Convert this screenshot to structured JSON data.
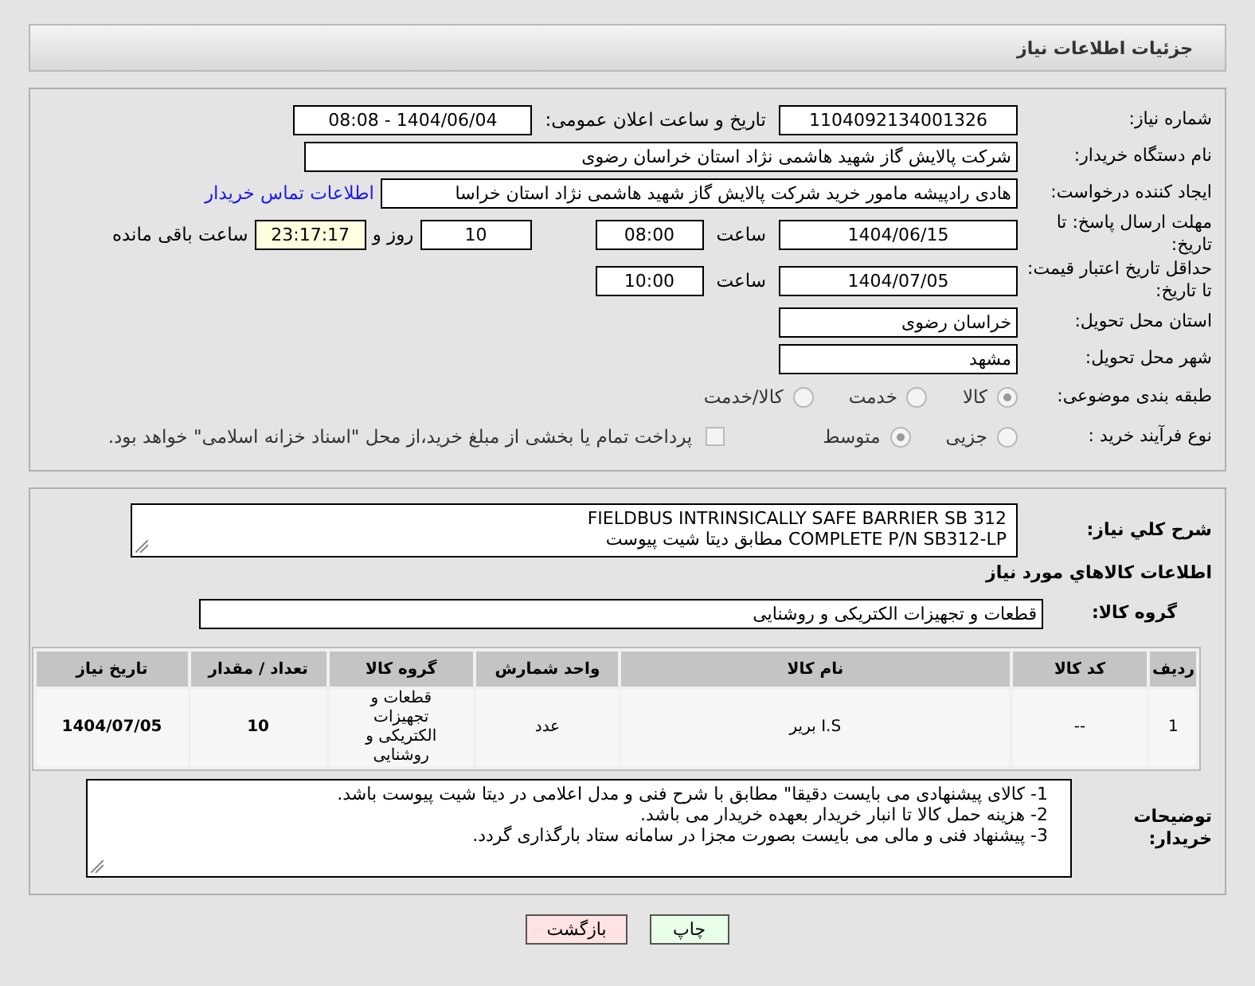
{
  "header": {
    "title": "جزئیات اطلاعات نیاز"
  },
  "need_number": {
    "label": "شماره نیاز:",
    "value": "1104092134001326"
  },
  "announce": {
    "label": "تاريخ و ساعت اعلان عمومی:",
    "value": "1404/06/04 - 08:08"
  },
  "buyer_org": {
    "label": "نام دستگاه خريدار:",
    "value": "شرکت پالایش گاز شهید هاشمی نژاد   استان خراسان رضوی"
  },
  "requester": {
    "label": "ايجاد کننده درخواست:",
    "value": "هادی رادپیشه مامور خرید شرکت پالایش گاز شهید هاشمی نژاد   استان خراسا",
    "link": "اطلاعات تماس خريدار"
  },
  "deadline": {
    "label": "مهلت ارسال پاسخ: تا تاريخ:",
    "date": "1404/06/15",
    "time_label": "ساعت",
    "time": "08:00",
    "days": "10",
    "days_label": "روز و",
    "remaining": "23:17:17",
    "remaining_label": "ساعت باقی مانده"
  },
  "validity": {
    "label": "حداقل تاريخ اعتبار قيمت: تا تاريخ:",
    "date": "1404/07/05",
    "time_label": "ساعت",
    "time": "10:00"
  },
  "province": {
    "label": "استان محل تحويل:",
    "value": "خراسان رضوی"
  },
  "city": {
    "label": "شهر محل تحويل:",
    "value": "مشهد"
  },
  "category": {
    "label": "طبقه بندی موضوعی:",
    "options": [
      {
        "label": "کالا",
        "selected": true
      },
      {
        "label": "خدمت",
        "selected": false
      },
      {
        "label": "کالا/خدمت",
        "selected": false
      }
    ]
  },
  "purchase_type": {
    "label": "نوع فرآيند خريد :",
    "options": [
      {
        "label": "جزیی",
        "selected": false
      },
      {
        "label": "متوسط",
        "selected": true
      }
    ],
    "note": {
      "label": "پرداخت تمام يا بخشی از مبلغ خريد،از محل \"اسناد خزانه اسلامی\" خواهد بود.",
      "checked": false
    }
  },
  "description": {
    "label": "شرح کلي نياز:",
    "lines": [
      "FIELDBUS INTRINSICALLY SAFE BARRIER SB 312",
      "COMPLETE P/N SB312-LP مطابق دیتا شیت پیوست"
    ]
  },
  "goods": {
    "title": "اطلاعات کالاهاي مورد نياز",
    "group_label": "گروه کالا:",
    "group_value": "قطعات و تجهيزات الکتريکی و روشنايی"
  },
  "table": {
    "columns": [
      "رديف",
      "کد کالا",
      "نام کالا",
      "واحد شمارش",
      "گروه کالا",
      "تعداد / مقدار",
      "تاريخ نياز"
    ],
    "rows": [
      [
        "1",
        "--",
        "I.S برير",
        "عدد",
        "قطعات و تجهيزات الکتريکی و روشنايی",
        "10",
        "1404/07/05"
      ]
    ]
  },
  "buyer_notes": {
    "label": "توضيحات خريدار:",
    "lines": [
      "1-    کالای پیشنهادی می بایست دقیقا\" مطابق با شرح فنی و مدل اعلامی در دیتا شیت پیوست باشد.",
      "2-    هزینه حمل کالا تا انبار خریدار بعهده خریدار می باشد.",
      "3-    پیشنهاد فنی و مالی می بایست بصورت مجزا در سامانه ستاد بارگذاری گردد."
    ]
  },
  "buttons": [
    {
      "label": "چاپ",
      "kind": "print"
    },
    {
      "label": "بازگشت",
      "kind": "back"
    }
  ]
}
